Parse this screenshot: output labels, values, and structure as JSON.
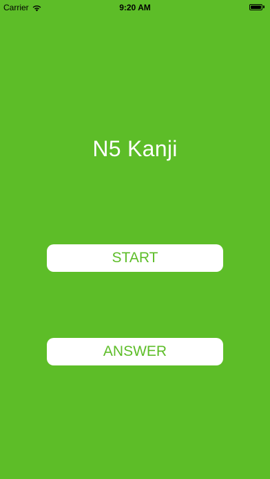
{
  "status_bar": {
    "carrier": "Carrier",
    "time": "9:20 AM",
    "battery_level": 1.0
  },
  "main": {
    "title": "N5 Kanji",
    "start_label": "START",
    "answer_label": "ANSWER"
  },
  "colors": {
    "background": "#5dbd28",
    "button_bg": "#ffffff",
    "button_text": "#5dbd28",
    "title_text": "#ffffff"
  }
}
